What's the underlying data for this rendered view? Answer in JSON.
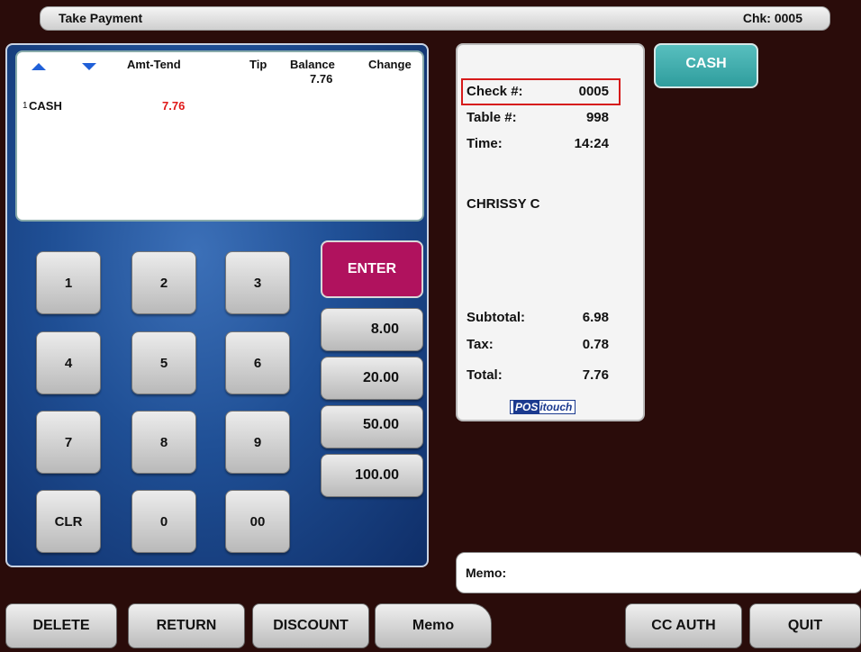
{
  "header": {
    "title": "Take Payment",
    "check_label": "Chk: 0005"
  },
  "tender": {
    "columns": [
      "Amt-Tend",
      "Tip",
      "Balance",
      "Change"
    ],
    "balance_value": "7.76",
    "rows": [
      {
        "index": "1",
        "type": "CASH",
        "amount": "7.76"
      }
    ]
  },
  "keypad": {
    "digits": [
      "1",
      "2",
      "3",
      "4",
      "5",
      "6",
      "7",
      "8",
      "9",
      "CLR",
      "0",
      "00"
    ],
    "enter_label": "ENTER",
    "quick_amounts": [
      "8.00",
      "20.00",
      "50.00",
      "100.00"
    ]
  },
  "receipt": {
    "check_label": "Check #:",
    "check_value": "0005",
    "table_label": "Table #:",
    "table_value": "998",
    "time_label": "Time:",
    "time_value": "14:24",
    "server": "CHRISSY C",
    "subtotal_label": "Subtotal:",
    "subtotal_value": "6.98",
    "tax_label": "Tax:",
    "tax_value": "0.78",
    "total_label": "Total:",
    "total_value": "7.76",
    "logo_pos": "POS",
    "logo_rest": "itouch"
  },
  "cash_button": "CASH",
  "memo_label": "Memo:",
  "footer": {
    "delete": "DELETE",
    "return": "RETURN",
    "discount": "DISCOUNT",
    "memo": "Memo",
    "cc_auth": "CC AUTH",
    "quit": "QUIT"
  },
  "colors": {
    "accent_enter": "#b0125e",
    "cash_button": "#3aa9a9",
    "amount_red": "#e01818",
    "highlight": "#d61a1a"
  }
}
